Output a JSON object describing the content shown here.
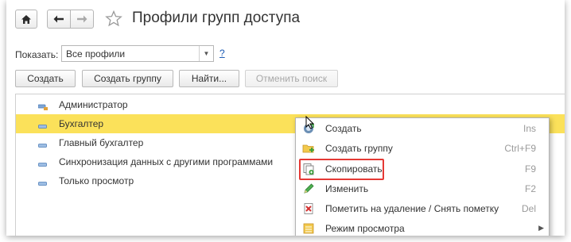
{
  "header": {
    "title": "Профили групп доступа",
    "home_icon": "home-icon",
    "back_icon": "arrow-left-icon",
    "forward_icon": "arrow-right-icon",
    "favorite_icon": "star-icon"
  },
  "filter": {
    "label": "Показать:",
    "value": "Все профили",
    "help": "?"
  },
  "toolbar": {
    "create_label": "Создать",
    "create_group_label": "Создать группу",
    "find_label": "Найти...",
    "cancel_search_label": "Отменить поиск"
  },
  "list": {
    "items": [
      {
        "label": "Администратор",
        "icon": "profile-locked-icon",
        "selected": false
      },
      {
        "label": "Бухгалтер",
        "icon": "profile-icon",
        "selected": true
      },
      {
        "label": "Главный бухгалтер",
        "icon": "profile-icon",
        "selected": false
      },
      {
        "label": "Синхронизация данных с другими программами",
        "icon": "profile-icon",
        "selected": false
      },
      {
        "label": "Только просмотр",
        "icon": "profile-icon",
        "selected": false
      }
    ]
  },
  "context_menu": {
    "items": [
      {
        "label": "Создать",
        "shortcut": "Ins",
        "icon": "create-icon"
      },
      {
        "label": "Создать группу",
        "shortcut": "Ctrl+F9",
        "icon": "create-folder-icon"
      },
      {
        "label": "Скопировать",
        "shortcut": "F9",
        "icon": "copy-icon",
        "highlighted": true
      },
      {
        "label": "Изменить",
        "shortcut": "F2",
        "icon": "pencil-icon"
      },
      {
        "label": "Пометить на удаление / Снять пометку",
        "shortcut": "Del",
        "icon": "delete-mark-icon"
      },
      {
        "label": "Режим просмотра",
        "shortcut": "",
        "icon": "view-mode-icon",
        "submenu": true
      }
    ]
  },
  "colors": {
    "selected_row": "#fbe15a",
    "highlight_border": "#e53935",
    "link": "#1d5cb5"
  }
}
